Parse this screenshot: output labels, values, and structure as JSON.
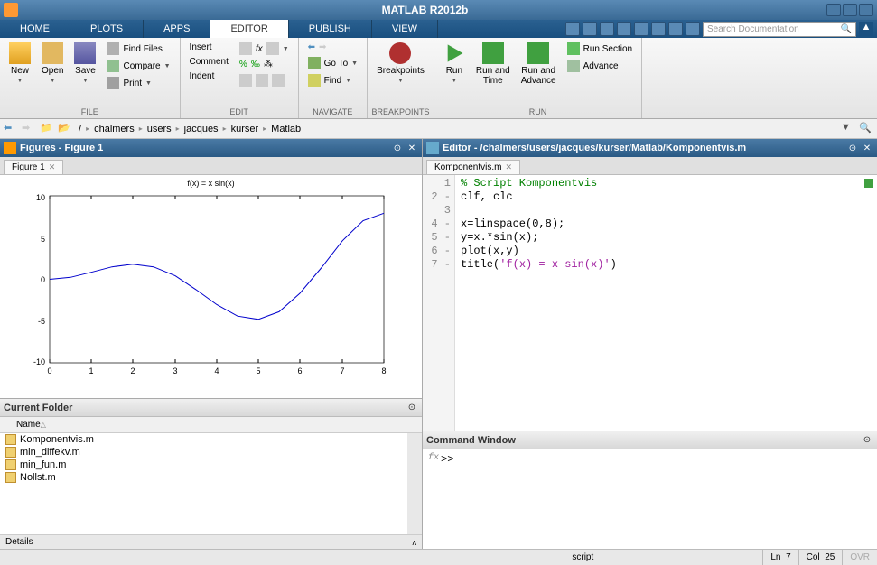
{
  "titlebar": {
    "title": "MATLAB R2012b"
  },
  "tabs": {
    "home": "HOME",
    "plots": "PLOTS",
    "apps": "APPS",
    "editor": "EDITOR",
    "publish": "PUBLISH",
    "view": "VIEW"
  },
  "search": {
    "placeholder": "Search Documentation"
  },
  "toolstrip": {
    "file": {
      "new": "New",
      "open": "Open",
      "save": "Save",
      "find": "Find Files",
      "compare": "Compare",
      "print": "Print",
      "label": "FILE"
    },
    "edit": {
      "insert": "Insert",
      "comment": "Comment",
      "indent": "Indent",
      "label": "EDIT"
    },
    "navigate": {
      "goto": "Go To",
      "find": "Find",
      "label": "NAVIGATE"
    },
    "breakpoints": {
      "btn": "Breakpoints",
      "label": "BREAKPOINTS"
    },
    "run": {
      "run": "Run",
      "runtime": "Run and\nTime",
      "runadv": "Run and\nAdvance",
      "runsec": "Run Section",
      "advance": "Advance",
      "label": "RUN"
    }
  },
  "breadcrumb": {
    "items": [
      "/",
      "chalmers",
      "users",
      "jacques",
      "kurser",
      "Matlab"
    ]
  },
  "figures": {
    "title": "Figures - Figure 1",
    "tab": "Figure 1",
    "plot_title": "f(x) = x sin(x)"
  },
  "folder": {
    "title": "Current Folder",
    "header": "Name",
    "files": [
      "Komponentvis.m",
      "min_diffekv.m",
      "min_fun.m",
      "Nollst.m"
    ],
    "details": "Details"
  },
  "editor": {
    "title": "Editor - /chalmers/users/jacques/kurser/Matlab/Komponentvis.m",
    "tab": "Komponentvis.m",
    "lines": [
      {
        "n": "1",
        "cls": "comment",
        "text": "% Script Komponentvis"
      },
      {
        "n": "2 -",
        "cls": "",
        "text": "clf, clc"
      },
      {
        "n": "3",
        "cls": "",
        "text": ""
      },
      {
        "n": "4 -",
        "cls": "",
        "text": "x=linspace(0,8);"
      },
      {
        "n": "5 -",
        "cls": "",
        "text": "y=x.*sin(x);"
      },
      {
        "n": "6 -",
        "cls": "",
        "text": "plot(x,y)"
      },
      {
        "n": "7 -",
        "cls": "string",
        "text": "title('f(x) = x sin(x)')"
      }
    ]
  },
  "cmd": {
    "title": "Command Window",
    "prompt": ">>"
  },
  "statusbar": {
    "script": "script",
    "ln": "Ln",
    "ln_val": "7",
    "col": "Col",
    "col_val": "25",
    "ovr": "OVR"
  },
  "chart_data": {
    "type": "line",
    "title": "f(x) = x sin(x)",
    "xlabel": "",
    "ylabel": "",
    "xlim": [
      0,
      8
    ],
    "ylim": [
      -10,
      10
    ],
    "xticks": [
      0,
      1,
      2,
      3,
      4,
      5,
      6,
      7,
      8
    ],
    "yticks": [
      -10,
      -5,
      0,
      5,
      10
    ],
    "x": [
      0,
      0.5,
      1,
      1.5,
      2,
      2.5,
      3,
      3.5,
      4,
      4.5,
      5,
      5.5,
      6,
      6.5,
      7,
      7.5,
      8
    ],
    "y": [
      0,
      0.24,
      0.84,
      1.5,
      1.82,
      1.5,
      0.42,
      -1.23,
      -3.03,
      -4.4,
      -4.79,
      -3.88,
      -1.68,
      1.4,
      4.6,
      7.03,
      7.91
    ]
  }
}
